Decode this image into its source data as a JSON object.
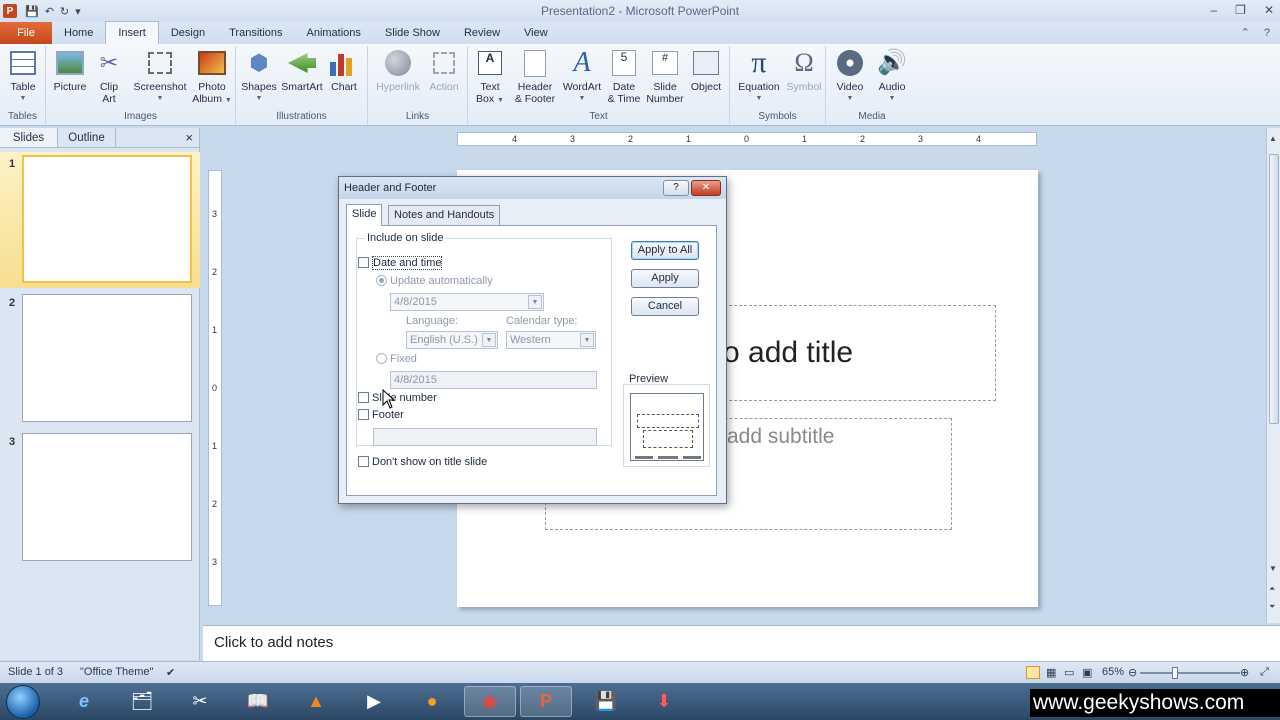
{
  "window": {
    "title": "Presentation2 - Microsoft PowerPoint",
    "app_badge": "P",
    "qat_items": [
      "save-icon",
      "undo-icon",
      "redo-icon",
      "customize-icon"
    ],
    "controls": [
      "–",
      "❐",
      "✕"
    ]
  },
  "ribbon_tabs": {
    "file": "File",
    "items": [
      "Home",
      "Insert",
      "Design",
      "Transitions",
      "Animations",
      "Slide Show",
      "Review",
      "View"
    ],
    "active": "Insert"
  },
  "ribbon": {
    "groups": {
      "tables": "Tables",
      "images": "Images",
      "illustrations": "Illustrations",
      "links": "Links",
      "text": "Text",
      "symbols": "Symbols",
      "media": "Media"
    },
    "buttons": {
      "table": "Table",
      "picture": "Picture",
      "clip_art_1": "Clip",
      "clip_art_2": "Art",
      "screenshot": "Screenshot",
      "photo_album_1": "Photo",
      "photo_album_2": "Album",
      "shapes": "Shapes",
      "smartart": "SmartArt",
      "chart": "Chart",
      "hyperlink": "Hyperlink",
      "action": "Action",
      "text_box_1": "Text",
      "text_box_2": "Box",
      "header_footer_1": "Header",
      "header_footer_2": "& Footer",
      "wordart": "WordArt",
      "date_time_1": "Date",
      "date_time_2": "& Time",
      "slide_number_1": "Slide",
      "slide_number_2": "Number",
      "object": "Object",
      "equation": "Equation",
      "symbol": "Symbol",
      "video": "Video",
      "audio": "Audio"
    },
    "glyphs": {
      "text_box": "A",
      "wordart": "A",
      "date_time": "5",
      "slide_number": "#",
      "equation": "π",
      "symbol": "Ω"
    }
  },
  "left_pane": {
    "tab_slides": "Slides",
    "tab_outline": "Outline",
    "close": "×",
    "slides": [
      "1",
      "2",
      "3"
    ]
  },
  "ruler": {
    "h_labels": [
      "4",
      "3",
      "2",
      "1",
      "0",
      "1",
      "2",
      "3",
      "4"
    ],
    "v_labels": [
      "3",
      "2",
      "1",
      "0",
      "1",
      "2",
      "3"
    ]
  },
  "slide": {
    "title_placeholder": "o add title",
    "subtitle_placeholder": "add subtitle"
  },
  "notes": {
    "placeholder": "Click to add notes"
  },
  "status": {
    "slide_info": "Slide 1 of 3",
    "theme": "\"Office Theme\"",
    "zoom": "65%",
    "zoom_level": 0.65
  },
  "dialog": {
    "title": "Header and Footer",
    "help": "?",
    "close": "✕",
    "tab_slide": "Slide",
    "tab_notes": "Notes and Handouts",
    "include_legend": "Include on slide",
    "date_time": "Date and time",
    "update_auto": "Update automatically",
    "date_value": "4/8/2015",
    "language_label": "Language:",
    "language_value": "English (U.S.)",
    "calendar_label": "Calendar type:",
    "calendar_value": "Western",
    "fixed": "Fixed",
    "fixed_value": "4/8/2015",
    "slide_number": "Slide number",
    "footer": "Footer",
    "footer_value": "",
    "dont_show": "Don't show on title slide",
    "apply_all": "Apply to All",
    "apply": "Apply",
    "cancel": "Cancel",
    "preview": "Preview",
    "dropdown_glyph": "▼"
  },
  "taskbar": {
    "items": [
      "ie-icon",
      "explorer-icon",
      "tool-icon",
      "ebook-icon",
      "vlc-icon",
      "media-icon",
      "firefox-icon",
      "chrome-icon",
      "powerpoint-icon",
      "file-manager-icon",
      "download-icon"
    ],
    "glyphs": {
      "ie": "e",
      "powerpoint": "P",
      "download": "⬇"
    },
    "watermark": "www.geekyshows.com"
  },
  "colors": {
    "file_tab": "#c4471b",
    "accent": "#3c7fb1",
    "selected_slide": "#f7df8e"
  }
}
